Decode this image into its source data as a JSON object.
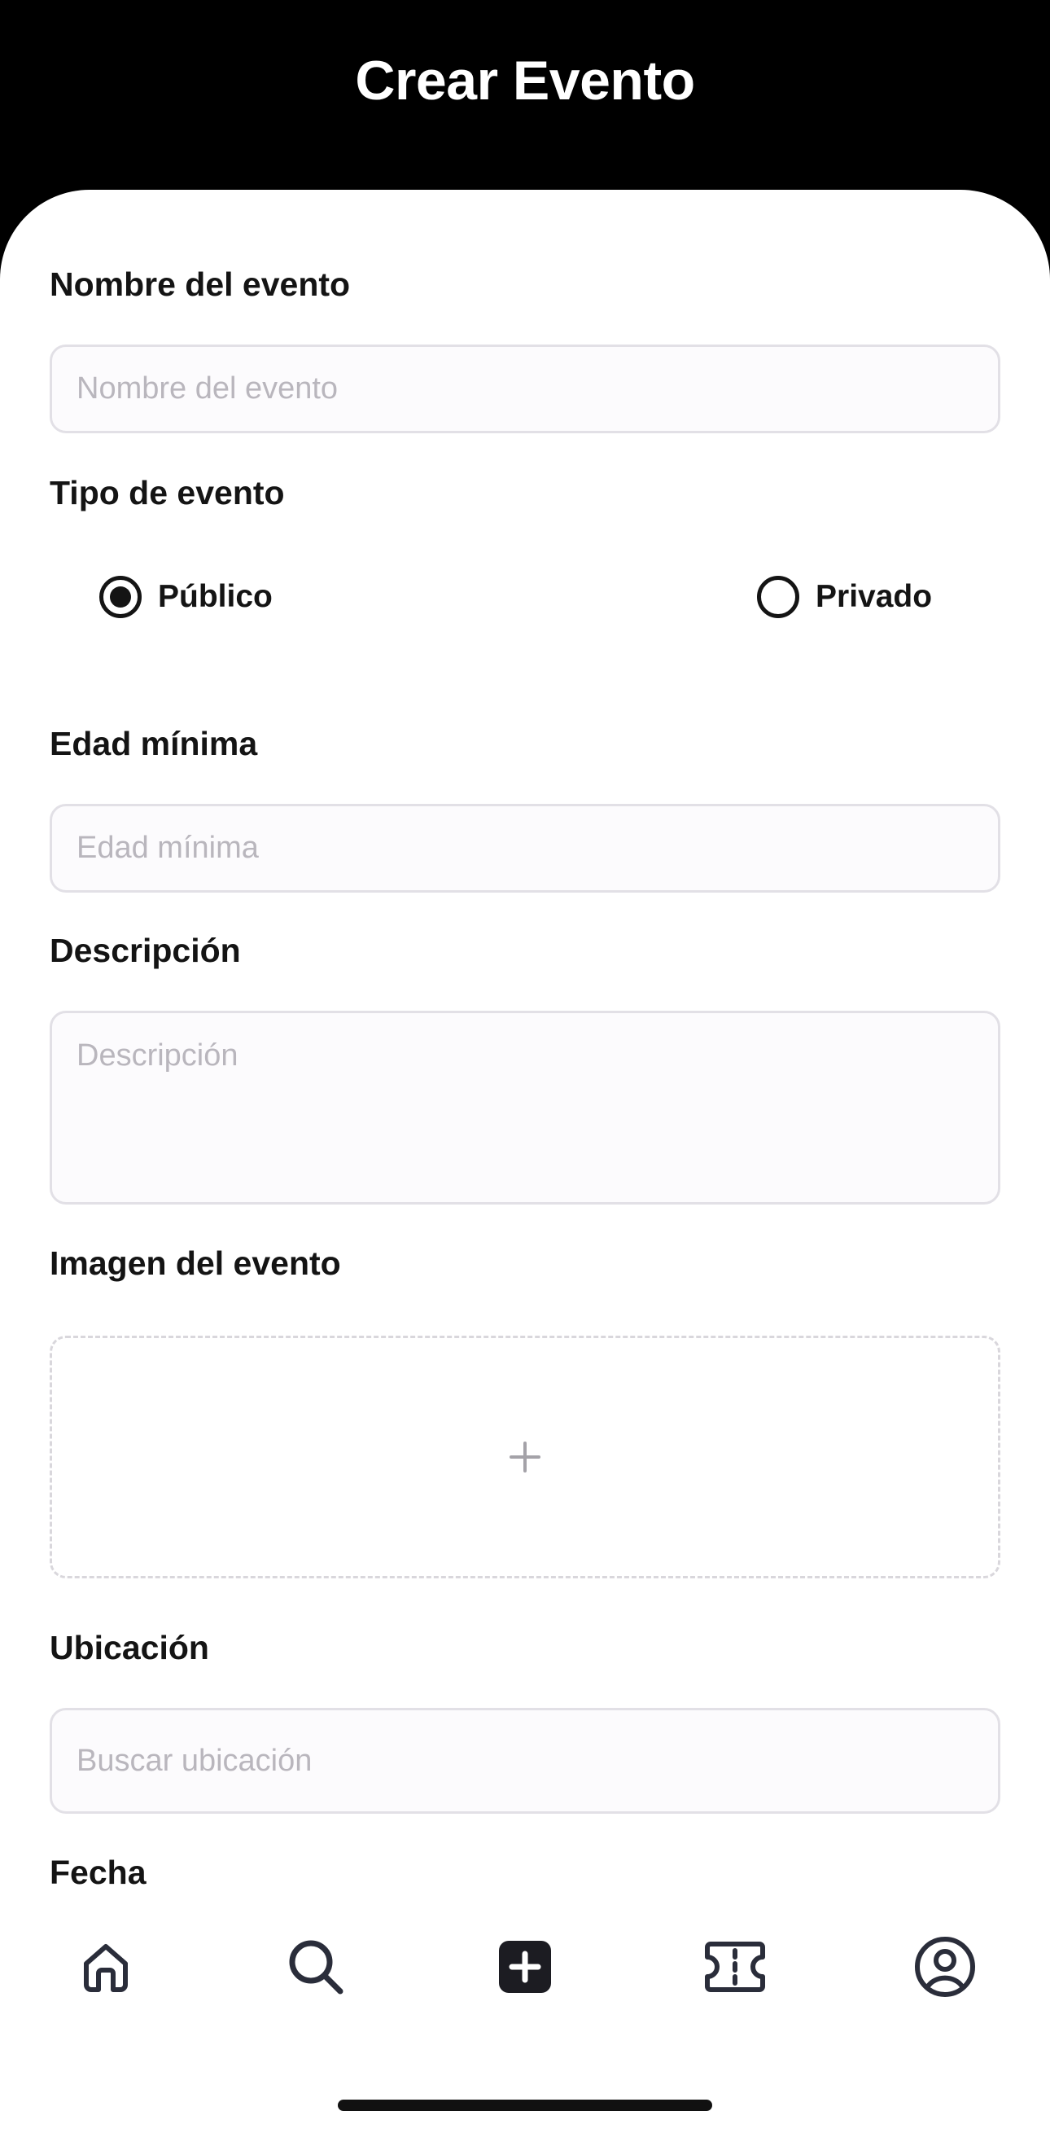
{
  "header": {
    "title": "Crear Evento"
  },
  "form": {
    "name": {
      "label": "Nombre del evento",
      "placeholder": "Nombre del evento",
      "value": ""
    },
    "type": {
      "label": "Tipo de evento",
      "options": [
        {
          "label": "Público",
          "selected": true
        },
        {
          "label": "Privado",
          "selected": false
        }
      ]
    },
    "min_age": {
      "label": "Edad mínima",
      "placeholder": "Edad mínima",
      "value": ""
    },
    "description": {
      "label": "Descripción",
      "placeholder": "Descripción",
      "value": ""
    },
    "image": {
      "label": "Imagen del evento",
      "icon": "plus-icon"
    },
    "location": {
      "label": "Ubicación",
      "placeholder": "Buscar ubicación",
      "value": ""
    },
    "date": {
      "label": "Fecha"
    }
  },
  "nav": {
    "items": [
      {
        "icon": "home-icon"
      },
      {
        "icon": "search-icon"
      },
      {
        "icon": "add-square-icon"
      },
      {
        "icon": "ticket-icon"
      },
      {
        "icon": "profile-icon"
      }
    ]
  },
  "colors": {
    "header_bg": "#000000",
    "text": "#141414",
    "placeholder": "#b9b6bd",
    "field_border": "#e2e0e6",
    "nav_icon": "#2a2d3a"
  }
}
